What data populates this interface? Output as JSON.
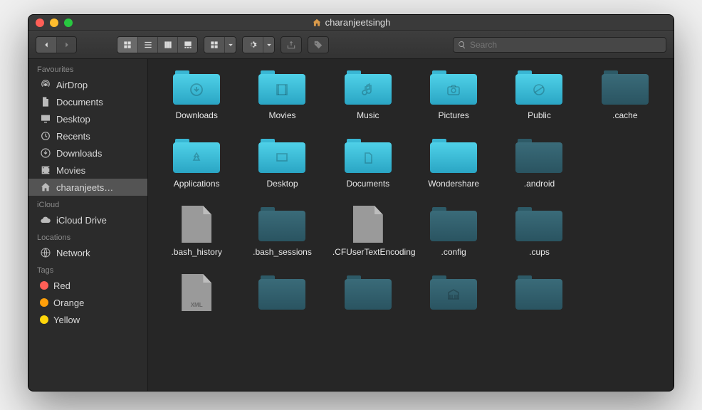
{
  "window": {
    "title": "charanjeetsingh"
  },
  "search": {
    "placeholder": "Search"
  },
  "sidebar": {
    "groups": [
      {
        "title": "Favourites",
        "items": [
          {
            "label": "AirDrop",
            "icon": "airdrop"
          },
          {
            "label": "Documents",
            "icon": "doc"
          },
          {
            "label": "Desktop",
            "icon": "desktop"
          },
          {
            "label": "Recents",
            "icon": "recents"
          },
          {
            "label": "Downloads",
            "icon": "downloads"
          },
          {
            "label": "Movies",
            "icon": "movies"
          },
          {
            "label": "charanjeets…",
            "icon": "home",
            "selected": true
          }
        ]
      },
      {
        "title": "iCloud",
        "items": [
          {
            "label": "iCloud Drive",
            "icon": "cloud"
          }
        ]
      },
      {
        "title": "Locations",
        "items": [
          {
            "label": "Network",
            "icon": "network"
          }
        ]
      },
      {
        "title": "Tags",
        "items": [
          {
            "label": "Red",
            "color": "#ff5f57"
          },
          {
            "label": "Orange",
            "color": "#ff9f0a"
          },
          {
            "label": "Yellow",
            "color": "#ffd60a"
          }
        ]
      }
    ]
  },
  "items": [
    {
      "label": "Downloads",
      "type": "folder",
      "glyph": "download",
      "style": "blue"
    },
    {
      "label": "Movies",
      "type": "folder",
      "glyph": "film",
      "style": "blue"
    },
    {
      "label": "Music",
      "type": "folder",
      "glyph": "music",
      "style": "blue"
    },
    {
      "label": "Pictures",
      "type": "folder",
      "glyph": "camera",
      "style": "blue"
    },
    {
      "label": "Public",
      "type": "folder",
      "glyph": "public",
      "style": "blue"
    },
    {
      "label": ".cache",
      "type": "folder",
      "style": "dim"
    },
    {
      "label": "Applications",
      "type": "folder",
      "glyph": "app",
      "style": "blue"
    },
    {
      "label": "Desktop",
      "type": "folder",
      "glyph": "desktop",
      "style": "blue"
    },
    {
      "label": "Documents",
      "type": "folder",
      "glyph": "doc",
      "style": "blue"
    },
    {
      "label": "Wondershare",
      "type": "folder",
      "style": "blue"
    },
    {
      "label": ".android",
      "type": "folder",
      "style": "dim"
    },
    {
      "label": "",
      "type": "empty"
    },
    {
      "label": ".bash_history",
      "type": "file"
    },
    {
      "label": ".bash_sessions",
      "type": "folder",
      "style": "dim"
    },
    {
      "label": ".CFUserTextEncoding",
      "type": "file"
    },
    {
      "label": ".config",
      "type": "folder",
      "style": "dim"
    },
    {
      "label": ".cups",
      "type": "folder",
      "style": "dim"
    },
    {
      "label": "",
      "type": "empty"
    },
    {
      "label": "",
      "type": "file",
      "xml": true
    },
    {
      "label": "",
      "type": "folder",
      "style": "dim"
    },
    {
      "label": "",
      "type": "folder",
      "style": "dim"
    },
    {
      "label": "",
      "type": "folder",
      "glyph": "library",
      "style": "dim"
    },
    {
      "label": "",
      "type": "folder",
      "style": "dim"
    },
    {
      "label": "",
      "type": "empty"
    }
  ]
}
